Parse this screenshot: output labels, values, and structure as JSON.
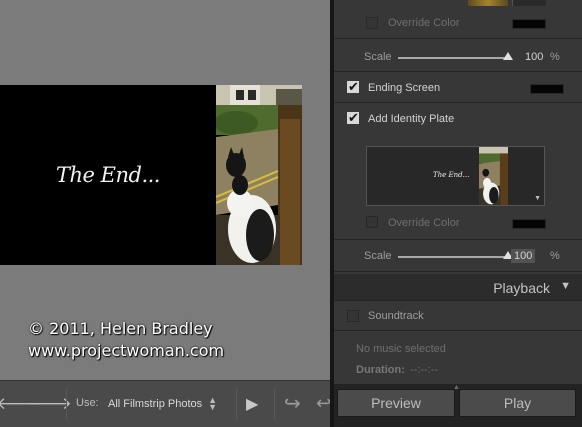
{
  "preview": {
    "slide_text": "The End...",
    "watermark_line1": "© 2011, Helen Bradley",
    "watermark_line2": "www.projectwoman.com"
  },
  "toolbar": {
    "prev_icon": "arrow-left-icon",
    "next_icon": "arrow-right-icon",
    "use_label": "Use:",
    "use_value": "All Filmstrip Photos",
    "play_icon": "play-icon",
    "rotate_icons": [
      "rotate-left-icon",
      "rotate-right-icon"
    ]
  },
  "panel": {
    "top_override_color_label": "Override Color",
    "top_scale_label": "Scale",
    "top_scale_value": "100",
    "top_scale_unit": "%",
    "top_scale_level": 1.0,
    "ending_screen_label": "Ending Screen",
    "ending_screen_checked": true,
    "add_identity_plate_label": "Add Identity Plate",
    "add_identity_plate_checked": true,
    "identity_plate_preview_text": "The End...",
    "override_color_label": "Override Color",
    "override_color_checked": false,
    "scale_label": "Scale",
    "scale_value": "100",
    "scale_unit": "%",
    "scale_level": 1.0,
    "playback_title": "Playback",
    "soundtrack_label": "Soundtrack",
    "soundtrack_checked": false,
    "no_music_text": "No music selected",
    "duration_label": "Duration:",
    "duration_value": "--:--:--",
    "preview_button": "Preview",
    "play_button": "Play"
  },
  "colors": {
    "panel_bg": "#373737",
    "preview_bg": "#7b7b7b",
    "swatch": "#050505"
  }
}
